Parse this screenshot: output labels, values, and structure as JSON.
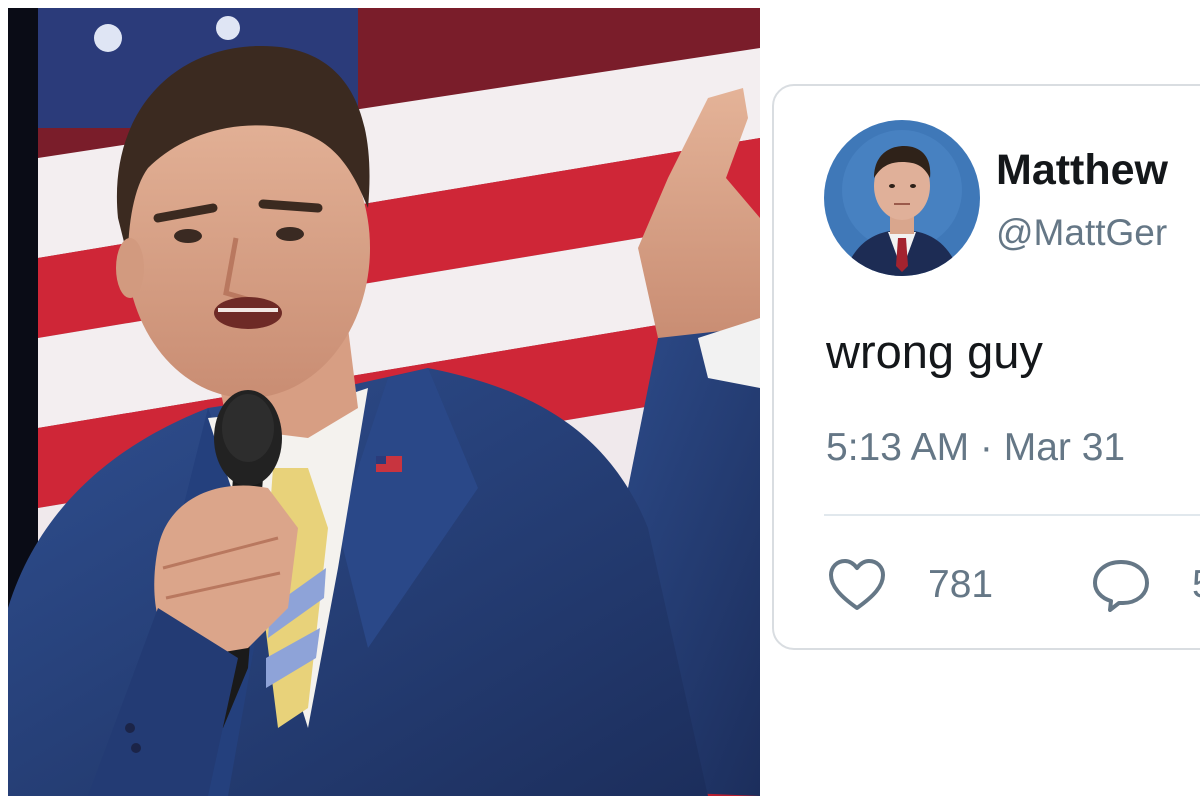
{
  "tweet": {
    "display_name": "Matthew",
    "handle": "@MattGer",
    "text": "wrong guy",
    "timestamp": "5:13 AM · Mar 31",
    "likes": "781",
    "replies": "5"
  },
  "icons": {
    "like": "heart-icon",
    "reply": "speech-bubble-icon"
  },
  "colors": {
    "text_primary": "#14171a",
    "text_secondary": "#657786",
    "card_border": "#d9dde1"
  }
}
